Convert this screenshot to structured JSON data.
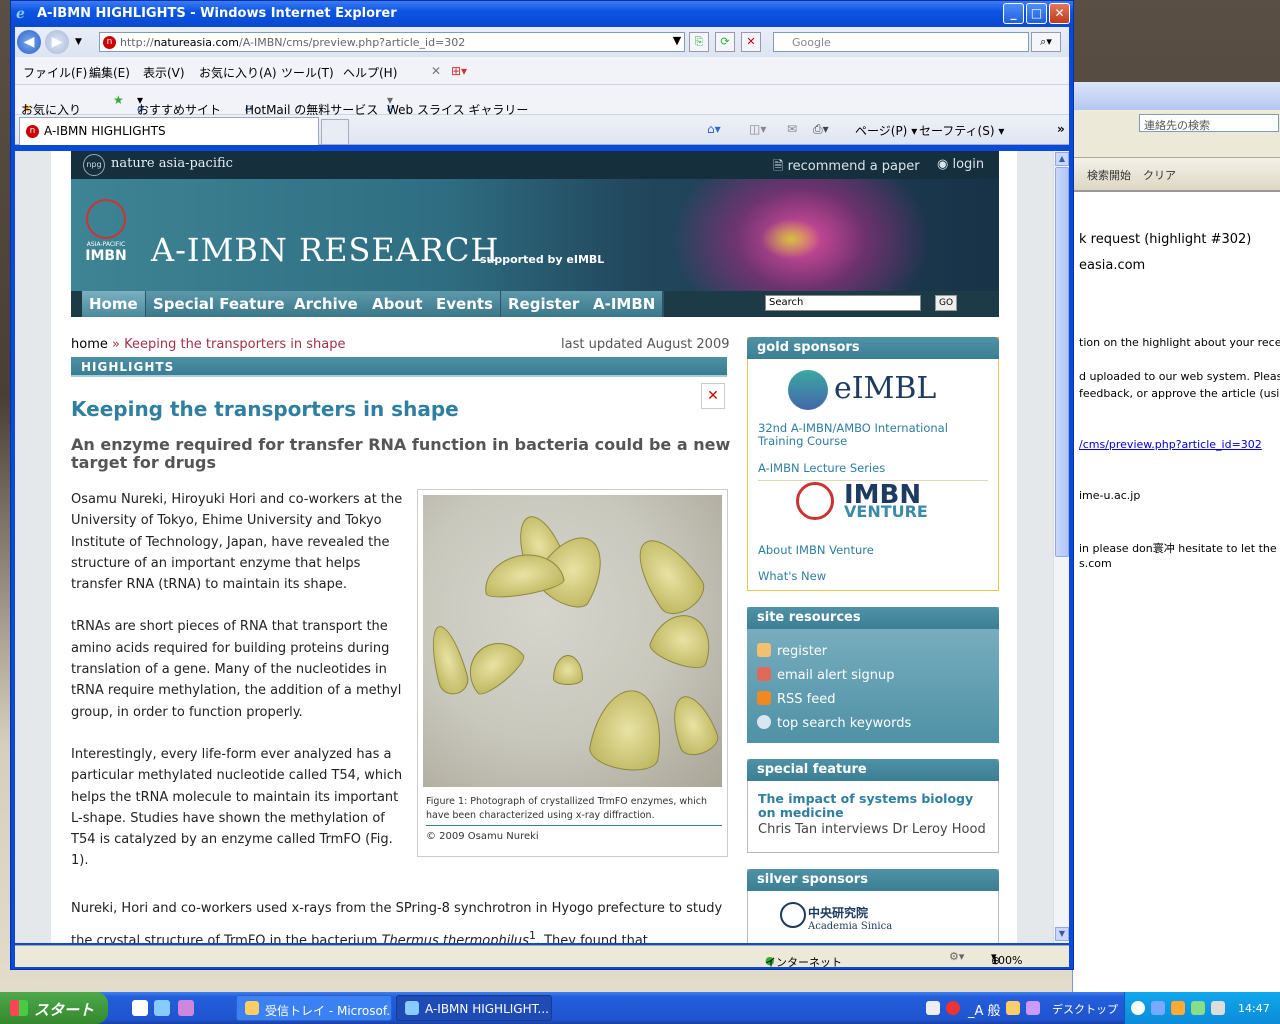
{
  "window": {
    "title": "A-IBMN HIGHLIGHTS - Windows Internet Explorer",
    "minimize": "_",
    "maximize": "□",
    "close": "✕"
  },
  "address": {
    "url_prefix": "http://",
    "url_domain": "natureasia.com",
    "url_path": "/A-IMBN/cms/preview.php?article_id=302",
    "search_placeholder": "Google"
  },
  "menu": [
    "ファイル(F)",
    "編集(E)",
    "表示(V)",
    "お気に入り(A)",
    "ツール(T)",
    "ヘルプ(H)"
  ],
  "favorites_bar": {
    "favorites": "お気に入り",
    "suggested": "おすすめサイト",
    "hotmail": "HotMail の無料サービス",
    "web_slice": "Web スライス ギャラリー"
  },
  "tab": {
    "title": "A-IBMN HIGHLIGHTS",
    "page_cmd": "ページ(P)",
    "safety_cmd": "セーフティ(S)"
  },
  "status": {
    "zone": "インターネット",
    "zoom": "100%"
  },
  "site": {
    "brand": "nature asia-pacific",
    "recommend": "recommend a paper",
    "login": "login",
    "title": "A-IMBN RESEARCH",
    "supported": "supported by eIMBL",
    "logo_small": "ASIA-PACIFIC",
    "logo_big": "IMBN",
    "nav": [
      "Home",
      "Special Feature",
      "Archive",
      "About",
      "Events",
      "Register",
      "A-IMBN"
    ],
    "search_value": "Search",
    "go": "GO"
  },
  "article": {
    "crumb_home": "home",
    "crumb_sep": "»",
    "crumb_current": "Keeping the transporters in shape",
    "updated": "last updated August 2009",
    "section": "HIGHLIGHTS",
    "close": "✕",
    "title": "Keeping the transporters in shape",
    "subtitle": "An enzyme required for transfer RNA function in bacteria could be a new target for drugs",
    "p1": "Osamu Nureki, Hiroyuki Hori and co-workers at the University of Tokyo, Ehime University and Tokyo Institute of Technology, Japan, have revealed the structure of an important enzyme that helps transfer RNA (tRNA) to maintain its shape.",
    "p2": "tRNAs are short pieces of RNA that transport the amino acids required for building proteins during translation of a gene. Many of the nucleotides in tRNA require methylation, the addition of a methyl group, in order to function properly.",
    "p3": "Interestingly, every life-form ever analyzed has a particular methylated nucleotide called T54, which helps the tRNA molecule to maintain its important L-shape. Studies have shown the methylation of T54 is catalyzed by an enzyme called TrmFO (Fig. 1).",
    "p4a": "Nureki, Hori and co-workers used x-rays from the SPring-8 synchrotron in Hyogo prefecture to study the crystal structure of TrmFO in the bacterium ",
    "p4_italic": "Thermus thermophilus",
    "p4_sup": "1",
    "p4b": ". They found that",
    "fig_caption": "Figure 1: Photograph of crystallized TrmFO enzymes, which have been characterized using x-ray diffraction.",
    "fig_credit": "© 2009 Osamu Nureki"
  },
  "sidebar": {
    "gold_title": "gold sponsors",
    "eimbl": "eIMBL",
    "link1": "32nd A-IMBN/AMBO International Training Course",
    "link2": "A-IMBN Lecture Series",
    "imbn": "IMBN",
    "venture": "VENTURE",
    "link3": "About IMBN Venture",
    "link4": "What's New",
    "res_title": "site resources",
    "res": [
      "register",
      "email alert signup",
      "RSS feed",
      "top search keywords"
    ],
    "spec_title": "special feature",
    "spec_link": "The impact of systems biology on medicine",
    "spec_sub": "Chris Tan interviews Dr Leroy Hood",
    "silver_title": "silver sponsors",
    "acad_cn": "中央研究院",
    "acad_en": "Academia Sinica"
  },
  "background_window": {
    "search": "連絡先の検索",
    "start_search": "検索開始",
    "clear": "クリア",
    "line1": "k request (highlight #302)",
    "line2": "easia.com",
    "line3": "tion on the highlight about your rece",
    "line4": "d uploaded to our web system. Pleas",
    "line5": "feedback, or approve the article (usin",
    "line6": "/cms/preview.php?article_id=302",
    "line7": "ime-u.ac.jp",
    "line8": "in please don寰冲 hesitate to let the",
    "line9": "s.com"
  },
  "taskbar": {
    "start": "スタート",
    "task1": "受信トレイ - Microsof...",
    "task2": "A-IBMN HIGHLIGHT...",
    "ime": "_A 般",
    "desktop": "デスクトップ",
    "clock": "14:47"
  }
}
